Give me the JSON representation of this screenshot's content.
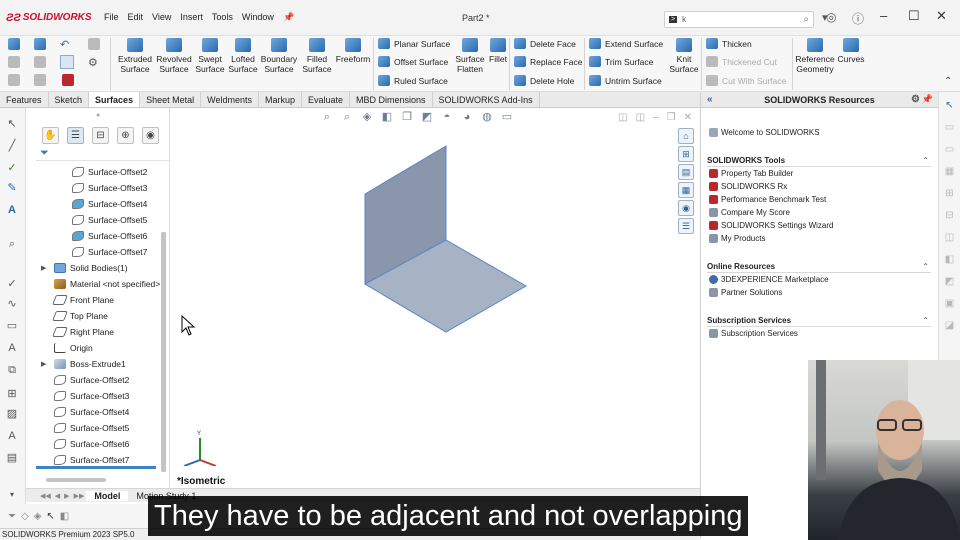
{
  "app": {
    "brand": "SOLIDWORKS",
    "document_title": "Part2 *",
    "menu": [
      "File",
      "Edit",
      "View",
      "Insert",
      "Tools",
      "Window"
    ],
    "search_value": "k"
  },
  "ribbon": {
    "large_buttons": [
      {
        "line1": "Extruded",
        "line2": "Surface"
      },
      {
        "line1": "Revolved",
        "line2": "Surface"
      },
      {
        "line1": "Swept",
        "line2": "Surface"
      },
      {
        "line1": "Lofted",
        "line2": "Surface"
      },
      {
        "line1": "Boundary",
        "line2": "Surface"
      },
      {
        "line1": "Filled",
        "line2": "Surface"
      },
      {
        "line1": "Freeform",
        "line2": ""
      }
    ],
    "col_a": [
      "Planar Surface",
      "Offset Surface",
      "Ruled Surface"
    ],
    "surface_flatten": {
      "line1": "Surface",
      "line2": "Flatten"
    },
    "fillet": "Fillet",
    "col_b": [
      "Delete Face",
      "Replace Face",
      "Delete Hole"
    ],
    "col_c": [
      "Extend Surface",
      "Trim Surface",
      "Untrim Surface"
    ],
    "knit": {
      "line1": "Knit",
      "line2": "Surface"
    },
    "col_d": [
      "Thicken",
      "Thickened Cut",
      "Cut With Surface"
    ],
    "ref_geom": {
      "line1": "Reference",
      "line2": "Geometry"
    },
    "curves": "Curves"
  },
  "tabs": [
    "Features",
    "Sketch",
    "Surfaces",
    "Sheet Metal",
    "Weldments",
    "Markup",
    "Evaluate",
    "MBD Dimensions",
    "SOLIDWORKS Add-Ins"
  ],
  "active_tab": "Surfaces",
  "tree": {
    "nested": [
      "Surface-Offset2",
      "Surface-Offset3",
      "Surface-Offset4",
      "Surface-Offset5",
      "Surface-Offset6",
      "Surface-Offset7"
    ],
    "solid_bodies": "Solid Bodies(1)",
    "material": "Material <not specified>",
    "planes": [
      "Front Plane",
      "Top Plane",
      "Right Plane"
    ],
    "origin": "Origin",
    "boss": "Boss-Extrude1",
    "top_level": [
      "Surface-Offset2",
      "Surface-Offset3",
      "Surface-Offset4",
      "Surface-Offset5",
      "Surface-Offset6",
      "Surface-Offset7"
    ]
  },
  "model_tabs": [
    "Model",
    "Motion Study 1"
  ],
  "viewport": {
    "view_label": "*Isometric",
    "triad_axis": "Y"
  },
  "resources": {
    "title": "SOLIDWORKS Resources",
    "welcome": "Welcome to SOLIDWORKS",
    "sections": [
      {
        "title": "SOLIDWORKS Tools",
        "items": [
          "Property Tab Builder",
          "SOLIDWORKS Rx",
          "Performance Benchmark Test",
          "Compare My Score",
          "SOLIDWORKS Settings Wizard",
          "My Products"
        ]
      },
      {
        "title": "Online Resources",
        "items": [
          "3DEXPERIENCE Marketplace",
          "Partner Solutions"
        ]
      },
      {
        "title": "Subscription Services",
        "items": [
          "Subscription Services"
        ]
      }
    ]
  },
  "status_text": "SOLIDWORKS Premium 2023 SP5.0",
  "subtitle": "They have to be adjacent and not overlapping",
  "colors": {
    "brand_red": "#c8102e",
    "surface_fill": "#8c98ad",
    "surface_edge": "#5b86c4",
    "selection_blue": "#3c82c8"
  }
}
